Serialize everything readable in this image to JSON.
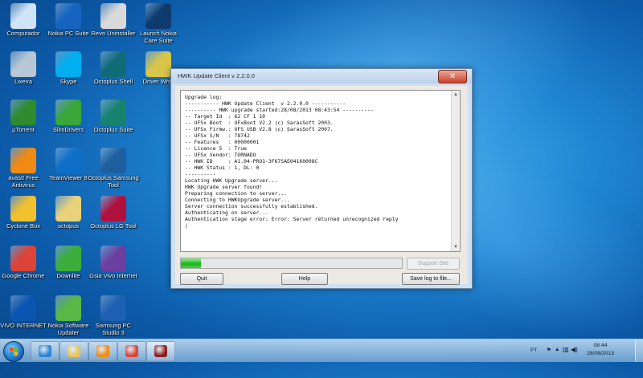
{
  "desktop": {
    "icons": [
      {
        "label": "Computador",
        "icon": "computer-icon",
        "color": "#cfe4f7"
      },
      {
        "label": "Nokia PC Suite",
        "icon": "nokia-pc-suite-icon",
        "color": "#1565c0"
      },
      {
        "label": "Revo Uninstaller",
        "icon": "revo-uninstaller-icon",
        "color": "#d9d9d9"
      },
      {
        "label": "Launch Nokia Care Suite",
        "icon": "nokia-care-suite-icon",
        "color": "#0d3b6e"
      },
      {
        "label": "Lixeira",
        "icon": "recycle-bin-icon",
        "color": "#b8c7d6"
      },
      {
        "label": "Skype",
        "icon": "skype-icon",
        "color": "#00aff0"
      },
      {
        "label": "Octoplus Shell",
        "icon": "octoplus-icon",
        "color": "#0f6b78"
      },
      {
        "label": "Driver Whiz",
        "icon": "driver-whiz-icon",
        "color": "#d8c64a"
      },
      {
        "label": "µTorrent",
        "icon": "utorrent-icon",
        "color": "#2e8b2e"
      },
      {
        "label": "SlimDrivers",
        "icon": "slimdrivers-icon",
        "color": "#3aa63a"
      },
      {
        "label": "Octoplus Suite",
        "icon": "octoplus-icon",
        "color": "#17836f"
      },
      {
        "label": "avast! Free Antivirus",
        "icon": "avast-icon",
        "color": "#f08a12"
      },
      {
        "label": "TeamViewer 8",
        "icon": "teamviewer-icon",
        "color": "#0e6fc7"
      },
      {
        "label": "Octoplus Samsung Tool",
        "icon": "octoplus-icon",
        "color": "#1d5e9e"
      },
      {
        "label": "Cyclone Box",
        "icon": "cyclone-box-icon",
        "color": "#f2c12e"
      },
      {
        "label": "octopus",
        "icon": "folder-icon",
        "color": "#e8d27a"
      },
      {
        "label": "Octoplus LG Tool",
        "icon": "octoplus-icon",
        "color": "#b0103c"
      },
      {
        "label": "Google Chrome",
        "icon": "chrome-icon",
        "color": "#db4437"
      },
      {
        "label": "Downlite",
        "icon": "downlite-icon",
        "color": "#3cae3c"
      },
      {
        "label": "Gsia Vivo Internet",
        "icon": "vivo-internet-icon",
        "color": "#6b3fa0"
      },
      {
        "label": "VIVO INTERNET",
        "icon": "vivo-icon",
        "color": "#0a55b0"
      },
      {
        "label": "Nokia Software Updater",
        "icon": "nokia-software-updater-icon",
        "color": "#58b848"
      },
      {
        "label": "Samsung PC Studio 3",
        "icon": "samsung-pc-studio-icon",
        "color": "#1d5fb0"
      }
    ]
  },
  "window": {
    "title": "HWK Update Client  v 2.2.0.0",
    "close_glyph": "✕",
    "log_lines": [
      "Upgrade log:",
      "----------- HWK Update Client  v 2.2.0.0 -----------",
      "---------- HWK upgrade started:28/08/2013 08:43:54 ----------",
      "-- Target Id  : 62 CF 1 10",
      "-- UFSx Boot  : UFxBoot V2.2 (c) SarasSoft 2003.",
      "-- UFSx Firmw.: UFS_USB V2.8 (c) SarasSoft 2007.",
      "-- UFSx S/N   : 78742",
      "-- Features   : 00000001",
      "-- Licence 5  : True",
      "-- UFSx Vendor: TORNADO",
      "-- HWK ID     : A1.04-PRO1-3F67SAE04160008C",
      "-- HWK Status : 1, DL: 0",
      "----------",
      "Locating HWK Upgrade server...",
      "HWK Upgrade server found!",
      "Preparing connection to server...",
      "Connecting to HWKUpgrade server...",
      "Server connection successfully established.",
      "Authenticating on server...",
      "Authentication stage error: Error: Server returned unrecognized reply"
    ],
    "progress_fraction": 0.09,
    "progress_color": "#22b322",
    "buttons": {
      "support_site": "Support Site",
      "quit": "Quit",
      "help": "Help",
      "save_log": "Save log to file..."
    }
  },
  "taskbar": {
    "apps": [
      {
        "name": "internet-explorer",
        "icon": "ie-icon",
        "color": "#2b84d6"
      },
      {
        "name": "file-explorer",
        "icon": "folder-icon",
        "color": "#e6c45a"
      },
      {
        "name": "media-player",
        "icon": "media-player-icon",
        "color": "#f08a12"
      },
      {
        "name": "chrome",
        "icon": "chrome-icon",
        "color": "#db4437"
      },
      {
        "name": "hwk-update-client",
        "icon": "hwk-icon",
        "color": "#8a1e1e"
      }
    ],
    "language": "PT",
    "clock_time": "08:44",
    "clock_date": "28/08/2013"
  }
}
